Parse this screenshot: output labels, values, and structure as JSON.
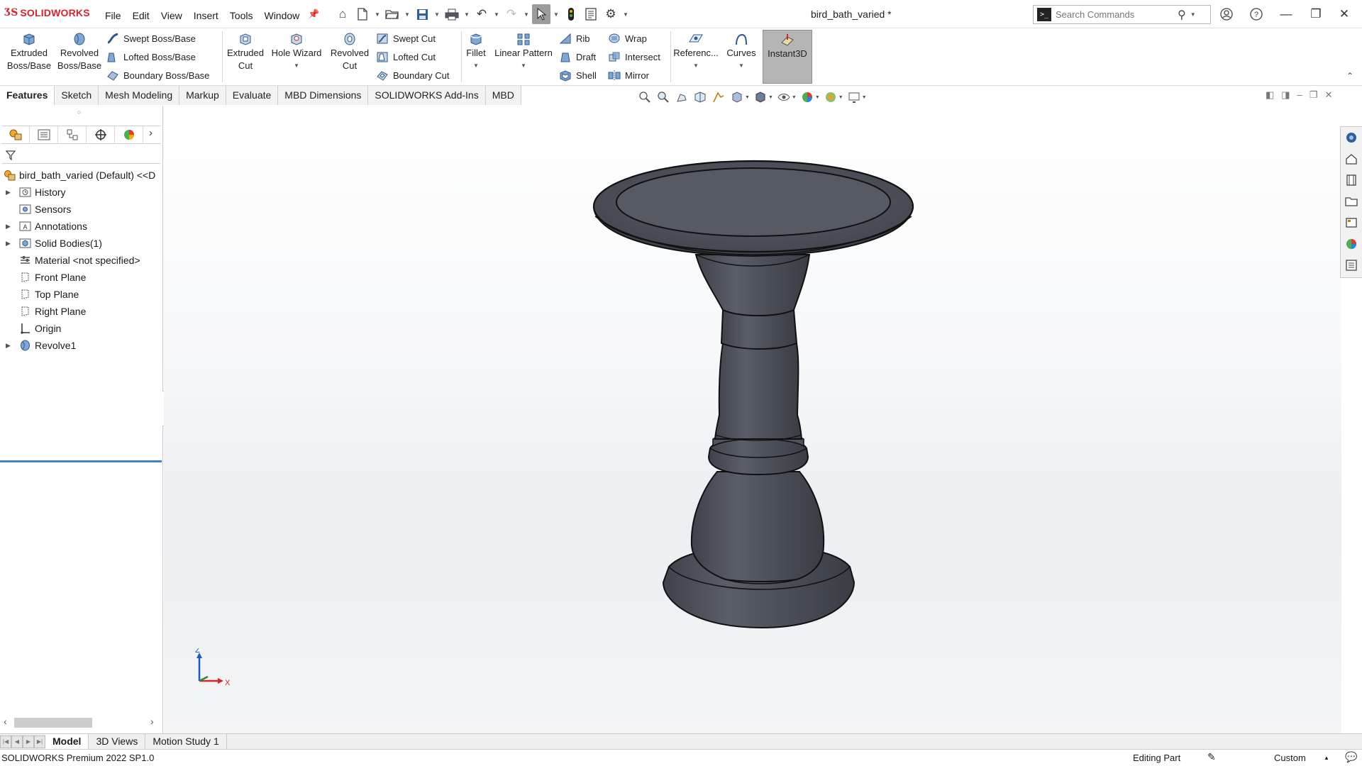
{
  "app": {
    "name": "SOLIDWORKS",
    "document_title": "bird_bath_varied *"
  },
  "menu": [
    "File",
    "Edit",
    "View",
    "Insert",
    "Tools",
    "Window"
  ],
  "search": {
    "placeholder": "Search Commands"
  },
  "ribbon": {
    "extruded_boss": "Extruded\nBoss/Base",
    "revolved_boss": "Revolved\nBoss/Base",
    "swept_boss": "Swept Boss/Base",
    "lofted_boss": "Lofted Boss/Base",
    "boundary_boss": "Boundary Boss/Base",
    "extruded_cut": "Extruded\nCut",
    "hole_wizard": "Hole Wizard",
    "revolved_cut": "Revolved\nCut",
    "swept_cut": "Swept Cut",
    "lofted_cut": "Lofted Cut",
    "boundary_cut": "Boundary Cut",
    "fillet": "Fillet",
    "linear_pattern": "Linear Pattern",
    "rib": "Rib",
    "draft": "Draft",
    "shell": "Shell",
    "wrap": "Wrap",
    "intersect": "Intersect",
    "mirror": "Mirror",
    "reference": "Referenc...",
    "curves": "Curves",
    "instant3d": "Instant3D"
  },
  "tabs": [
    "Features",
    "Sketch",
    "Mesh Modeling",
    "Markup",
    "Evaluate",
    "MBD Dimensions",
    "SOLIDWORKS Add-Ins",
    "MBD"
  ],
  "active_tab": "Features",
  "tree": {
    "root": "bird_bath_varied (Default) <<D",
    "items": [
      {
        "label": "History",
        "icon": "history-folder-icon",
        "expandable": true
      },
      {
        "label": "Sensors",
        "icon": "sensors-folder-icon",
        "expandable": false
      },
      {
        "label": "Annotations",
        "icon": "annotations-folder-icon",
        "expandable": true
      },
      {
        "label": "Solid Bodies(1)",
        "icon": "solid-bodies-folder-icon",
        "expandable": true
      },
      {
        "label": "Material <not specified>",
        "icon": "material-icon",
        "expandable": false
      },
      {
        "label": "Front Plane",
        "icon": "plane-icon",
        "expandable": false
      },
      {
        "label": "Top Plane",
        "icon": "plane-icon",
        "expandable": false
      },
      {
        "label": "Right Plane",
        "icon": "plane-icon",
        "expandable": false
      },
      {
        "label": "Origin",
        "icon": "origin-icon",
        "expandable": false
      },
      {
        "label": "Revolve1",
        "icon": "revolve-feature-icon",
        "expandable": true
      }
    ]
  },
  "triad": {
    "z": "Z",
    "x": "X"
  },
  "bottom_tabs": [
    "Model",
    "3D Views",
    "Motion Study 1"
  ],
  "active_bottom_tab": "Model",
  "status": {
    "version": "SOLIDWORKS Premium 2022 SP1.0",
    "mode": "Editing Part",
    "units": "Custom"
  },
  "colors": {
    "model_fill": "#4a4d55",
    "accent_red": "#d8232a",
    "rollback_bar": "#3d84c6"
  }
}
